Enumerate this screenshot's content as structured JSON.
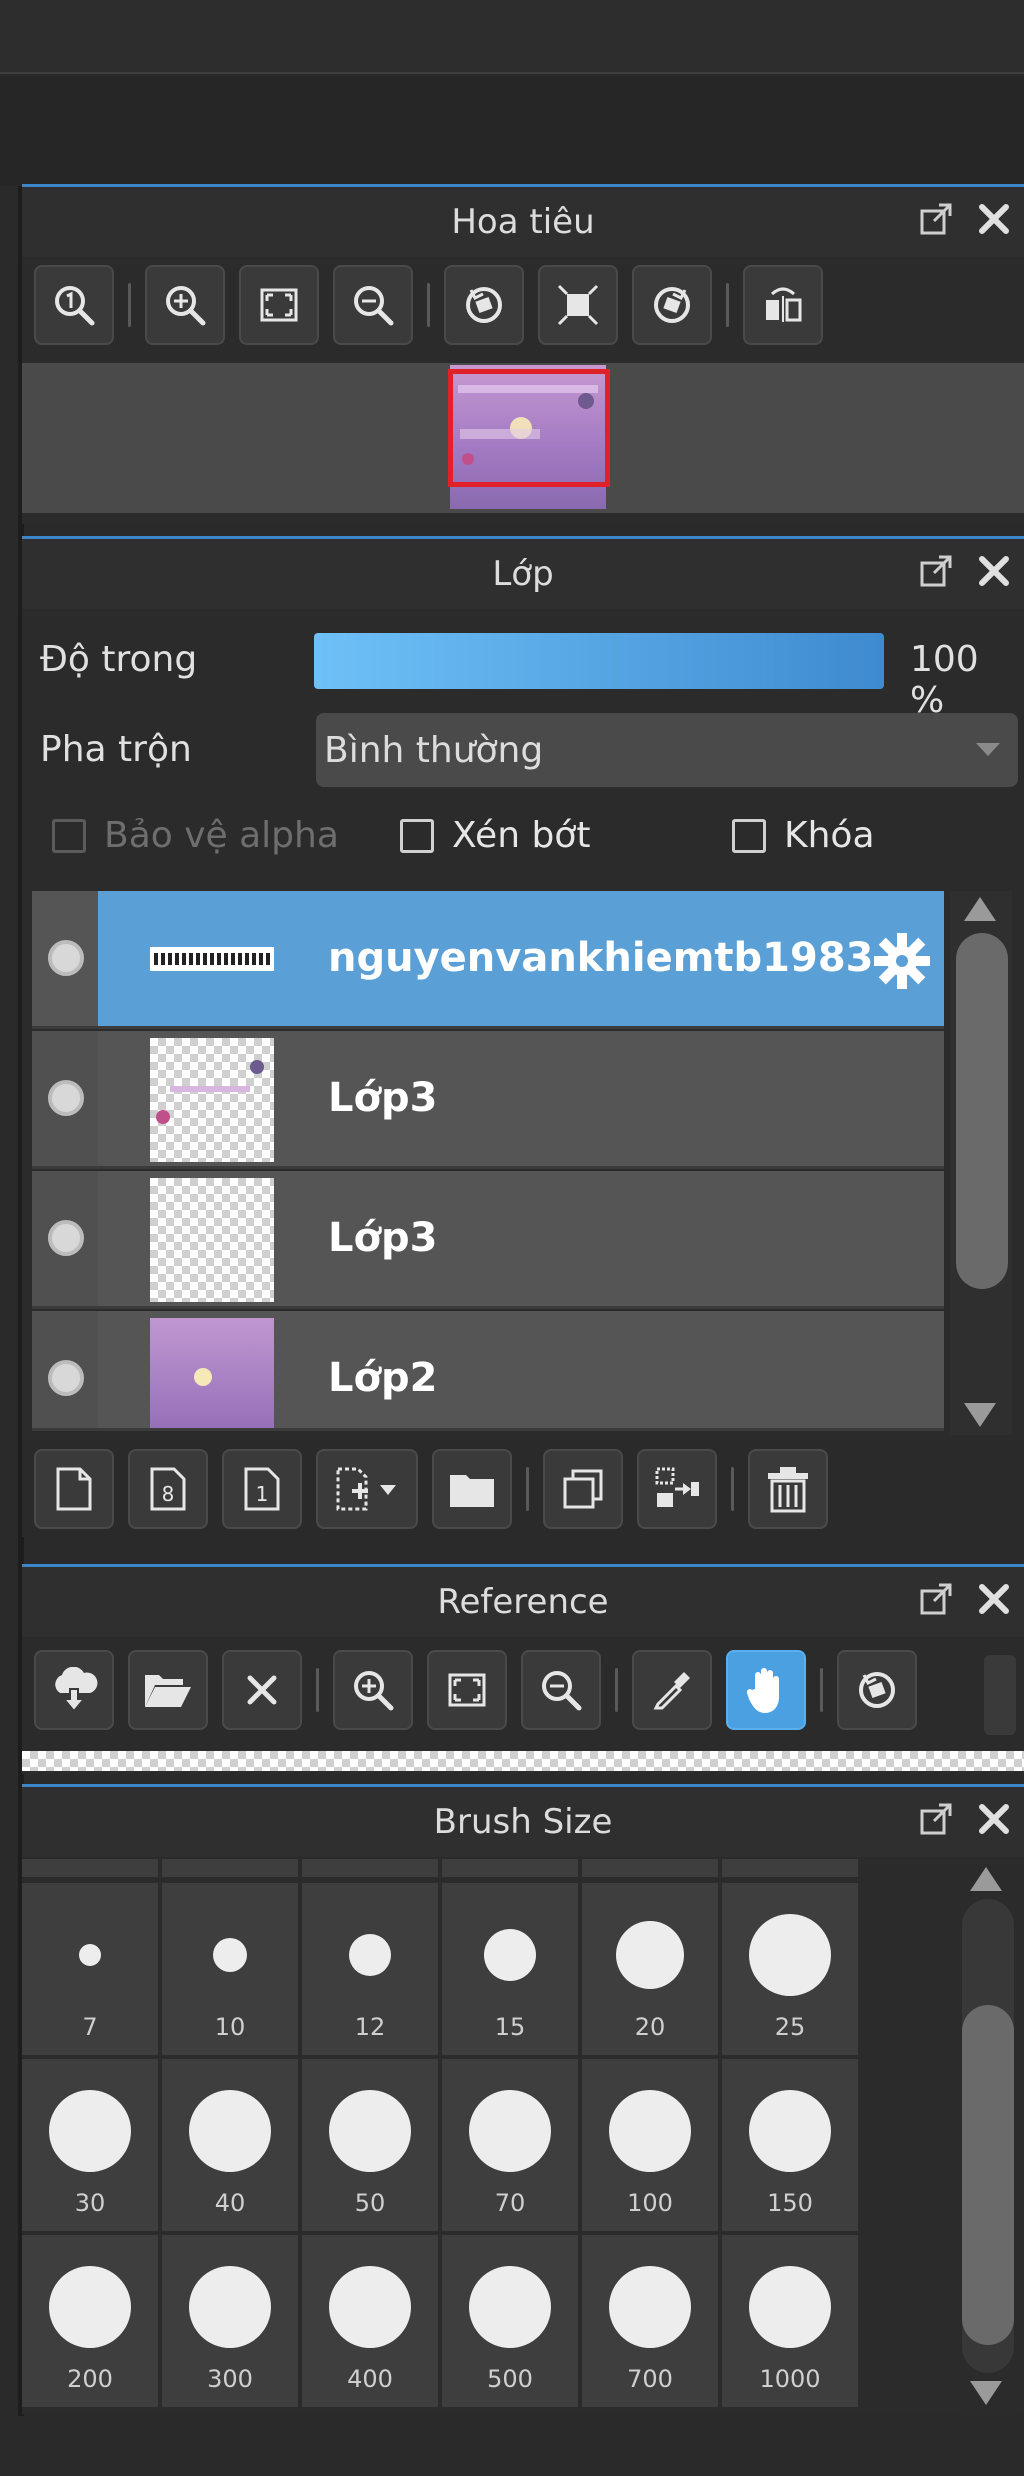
{
  "navigator": {
    "title": "Hoa tiêu"
  },
  "layer_panel": {
    "title": "Lớp",
    "opacity_label": "Độ trong",
    "opacity_value": 1.0,
    "opacity_text": "100 %",
    "blend_label": "Pha trộn",
    "blend_value": "Bình thường",
    "protect_alpha_label": "Bảo vệ alpha",
    "clipping_label": "Xén bớt",
    "lock_label": "Khóa",
    "layers": [
      {
        "name": "nguyenvankhiemtb1983",
        "selected": true
      },
      {
        "name": "Lớp3",
        "selected": false
      },
      {
        "name": "Lớp3",
        "selected": false
      },
      {
        "name": "Lớp2",
        "selected": false
      }
    ]
  },
  "reference": {
    "title": "Reference"
  },
  "brush_size": {
    "title": "Brush Size",
    "sizes": [
      "7",
      "10",
      "12",
      "15",
      "20",
      "25",
      "30",
      "40",
      "50",
      "70",
      "100",
      "150",
      "200",
      "300",
      "400",
      "500",
      "700",
      "1000"
    ]
  },
  "colors": {
    "accent": "#3c87c9",
    "selected_layer": "#5aa0d6",
    "active_tool": "#4aa0e0"
  }
}
